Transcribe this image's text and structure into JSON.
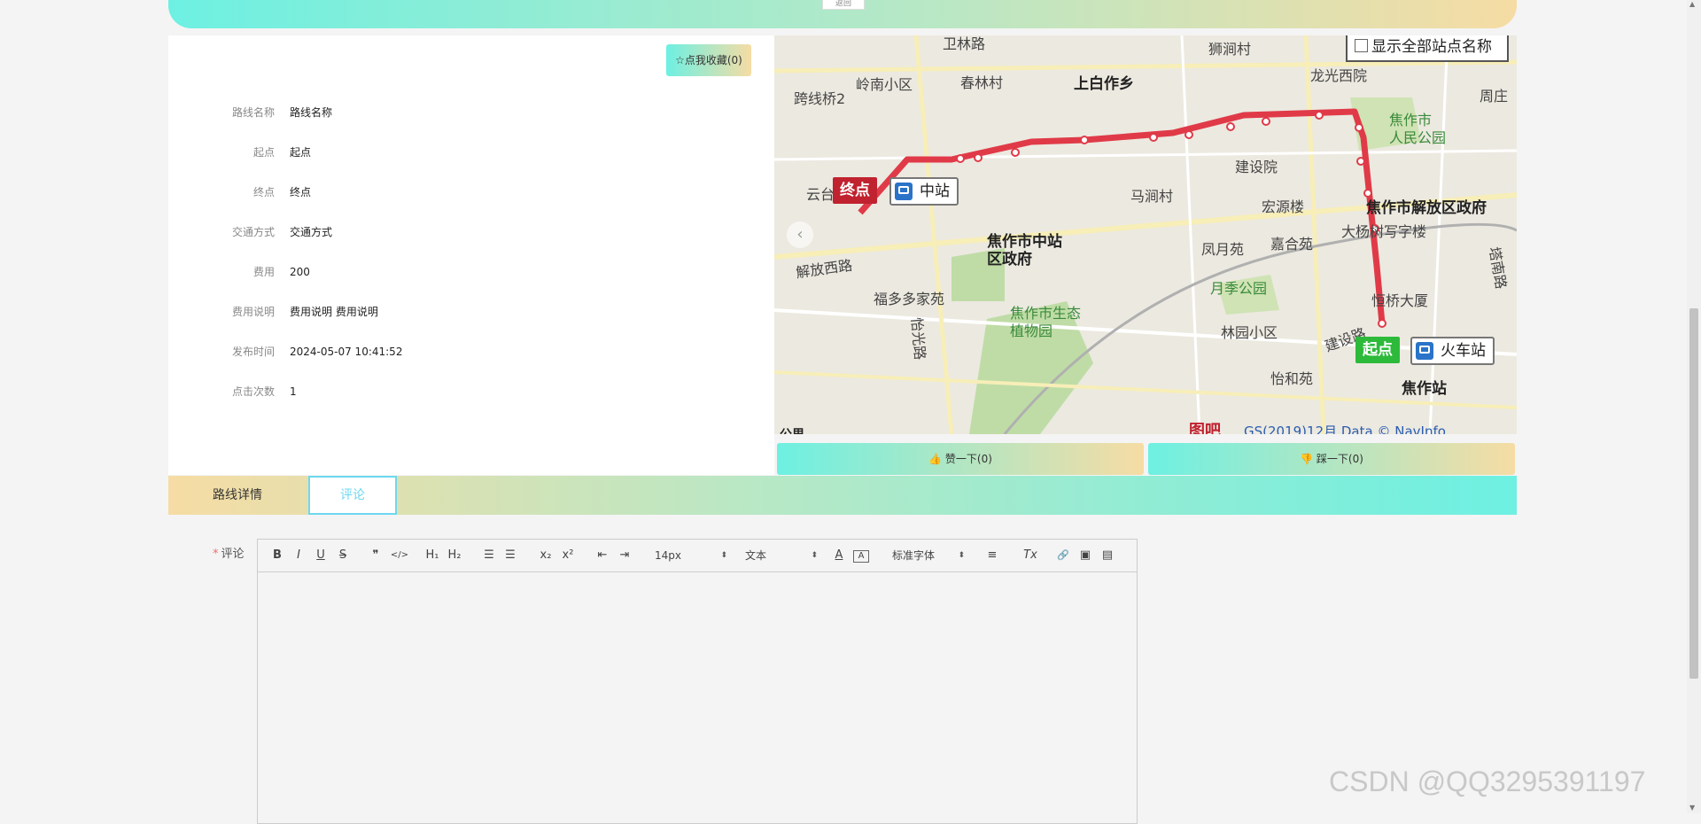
{
  "header": {
    "back_label": "返回"
  },
  "favorite": {
    "label": "☆点我收藏(0)"
  },
  "info": [
    {
      "label": "路线名称",
      "value": "路线名称"
    },
    {
      "label": "起点",
      "value": "起点"
    },
    {
      "label": "终点",
      "value": "终点"
    },
    {
      "label": "交通方式",
      "value": "交通方式"
    },
    {
      "label": "费用",
      "value": "200"
    },
    {
      "label": "费用说明",
      "value": "费用说明 费用说明"
    },
    {
      "label": "发布时间",
      "value": "2024-05-07 10:41:52"
    },
    {
      "label": "点击次数",
      "value": "1"
    }
  ],
  "map": {
    "toggle_label": "显示全部站点名称",
    "end_tag": "终点",
    "end_station": "中站",
    "start_tag": "起点",
    "start_station": "火车站",
    "places": {
      "p1": "卫林路",
      "p2": "狮涧村",
      "p3": "岭南小区",
      "p4": "春林村",
      "p5": "上白作乡",
      "p6": "龙光西院",
      "p7": "周庄",
      "p8": "跨线桥2",
      "p9": "焦作市",
      "p10": "人民公园",
      "p11": "建设院",
      "p12": "马涧村",
      "p13": "宏源楼",
      "p14": "焦作市解放区政府",
      "p15": "大杨树写字楼",
      "p16": "焦作市中站",
      "p17": "区政府",
      "p18": "凤月苑",
      "p19": "嘉合苑",
      "p20": "月季公园",
      "p21": "解放西路",
      "p22": "福多多家苑",
      "p23": "焦作市生态",
      "p24": "植物园",
      "p25": "林园小区",
      "p26": "恒桥大厦",
      "p27": "怡和苑",
      "p28": "焦作站",
      "p29": "塔南路",
      "p30": "云台",
      "p31": "怡光路",
      "p32": "建设路",
      "p33": "GS(2019)12月 Data © NavInfo",
      "p34": "图吧",
      "p35": "公里"
    }
  },
  "votes": {
    "up": "赞一下(0)",
    "down": "踩一下(0)"
  },
  "tabs": {
    "details": "路线详情",
    "comment": "评论"
  },
  "comment": {
    "label": "评论",
    "toolbar": {
      "bold": "B",
      "italic": "I",
      "underline": "U",
      "strike": "S",
      "quote": "❞",
      "code": "</>",
      "h1": "H₁",
      "h2": "H₂",
      "ol": "☰",
      "ul": "☰",
      "sub": "x₂",
      "sup": "x²",
      "outdent": "⇤",
      "indent": "⇥",
      "size": "14px",
      "header": "文本",
      "font": "标准字体",
      "color": "A",
      "bg": "A",
      "align": "≡",
      "clean": "Tx",
      "link": "🔗",
      "image": "▣",
      "video": "▤"
    }
  },
  "watermark": "CSDN @QQ3295391197"
}
